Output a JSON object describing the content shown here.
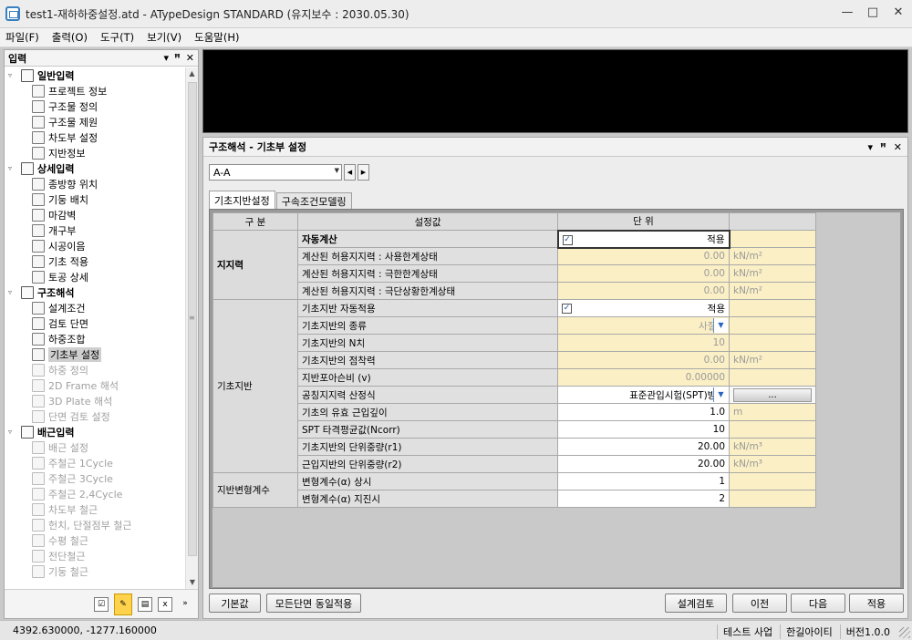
{
  "window": {
    "title": "test1-재하하중설정.atd - ATypeDesign STANDARD  (유지보수 : 2030.05.30)",
    "min": "—",
    "max": "□",
    "close": "✕"
  },
  "menu": [
    "파일(F)",
    "출력(O)",
    "도구(T)",
    "보기(V)",
    "도움말(H)"
  ],
  "left_panel": {
    "title": "입력",
    "tree": [
      {
        "label": "일반입력",
        "group": true,
        "exp": "▿"
      },
      {
        "label": "프로젝트 정보"
      },
      {
        "label": "구조물 정의"
      },
      {
        "label": "구조물 제원"
      },
      {
        "label": "차도부 설정"
      },
      {
        "label": "지반정보"
      },
      {
        "label": "상세입력",
        "group": true,
        "exp": "▿"
      },
      {
        "label": "종방향 위치"
      },
      {
        "label": "기둥 배치"
      },
      {
        "label": "마감벽"
      },
      {
        "label": "개구부"
      },
      {
        "label": "시공이음"
      },
      {
        "label": "기초 적용"
      },
      {
        "label": "토공 상세"
      },
      {
        "label": "구조해석",
        "group": true,
        "exp": "▿"
      },
      {
        "label": "설계조건"
      },
      {
        "label": "검토 단면"
      },
      {
        "label": "하중조합"
      },
      {
        "label": "기초부 설정",
        "selected": true
      },
      {
        "label": "하중 정의",
        "disabled": true
      },
      {
        "label": "2D Frame 해석",
        "disabled": true
      },
      {
        "label": "3D Plate 해석",
        "disabled": true
      },
      {
        "label": "단면 검토 설정",
        "disabled": true
      },
      {
        "label": "배근입력",
        "group": true,
        "exp": "▿"
      },
      {
        "label": "배근 설정",
        "disabled": true
      },
      {
        "label": "주철근 1Cycle",
        "disabled": true
      },
      {
        "label": "주철근 3Cycle",
        "disabled": true
      },
      {
        "label": "주철근 2,4Cycle",
        "disabled": true
      },
      {
        "label": "차도부 철근",
        "disabled": true
      },
      {
        "label": "헌치, 단절점부 철근",
        "disabled": true
      },
      {
        "label": "수평 철근",
        "disabled": true
      },
      {
        "label": "전단철근",
        "disabled": true
      },
      {
        "label": "기둥 철근",
        "disabled": true
      }
    ]
  },
  "right_panel": {
    "title": "구조해석 - 기초부 설정",
    "section_value": "A-A",
    "tabs": [
      "기초지반설정",
      "구속조건모델링"
    ],
    "headers": {
      "category": "구 분",
      "setting": "설정값",
      "unit": "단 위"
    },
    "categories": {
      "bearing": "지지력",
      "foundation": "기초지반",
      "ground": "지반변형계수"
    },
    "rows": {
      "auto_calc": {
        "label": "자동계산",
        "value": "적용",
        "checkbox": "✓"
      },
      "allow_service": {
        "label": "계산된 허용지지력 : 사용한계상태",
        "value": "0.00",
        "unit": "kN/m²"
      },
      "allow_ultimate": {
        "label": "계산된 허용지지력 : 극한한계상태",
        "value": "0.00",
        "unit": "kN/m²"
      },
      "allow_extreme": {
        "label": "계산된 허용지지력 : 극단상황한계상태",
        "value": "0.00",
        "unit": "kN/m²"
      },
      "auto_apply": {
        "label": "기초지반 자동적용",
        "value": "적용",
        "checkbox": "✓"
      },
      "soil_type": {
        "label": "기초지반의 종류",
        "value": "사질토"
      },
      "n_value": {
        "label": "기초지반의 N치",
        "value": "10"
      },
      "cohesion": {
        "label": "기초지반의 점착력",
        "value": "0.00",
        "unit": "kN/m²"
      },
      "poisson": {
        "label": "지반포아슨비 (v)",
        "value": "0.00000"
      },
      "method": {
        "label": "공칭지지력 산정식",
        "value": "표준관입시험(SPT)방법",
        "button": "..."
      },
      "depth": {
        "label": "기초의 유효 근입깊이",
        "value": "1.0",
        "unit": "m"
      },
      "spt": {
        "label": "SPT 타격평균값(Ncorr)",
        "value": "10"
      },
      "unit_weight_r1": {
        "label": "기초지반의 단위중량(r1)",
        "value": "20.00",
        "unit": "kN/m³"
      },
      "unit_weight_r2": {
        "label": "근입지반의 단위중량(r2)",
        "value": "20.00",
        "unit": "kN/m³"
      },
      "alpha_normal": {
        "label": "변형계수(α) 상시",
        "value": "1"
      },
      "alpha_quake": {
        "label": "변형계수(α) 지진시",
        "value": "2"
      }
    },
    "buttons": {
      "default": "기본값",
      "apply_all": "모든단면 동일적용",
      "design_check": "설계검토",
      "prev": "이전",
      "next": "다음",
      "apply": "적용"
    }
  },
  "status": {
    "coords": "4392.630000,  -1277.160000",
    "items": [
      "테스트 사업",
      "한길아이티",
      "버전1.0.0"
    ]
  }
}
